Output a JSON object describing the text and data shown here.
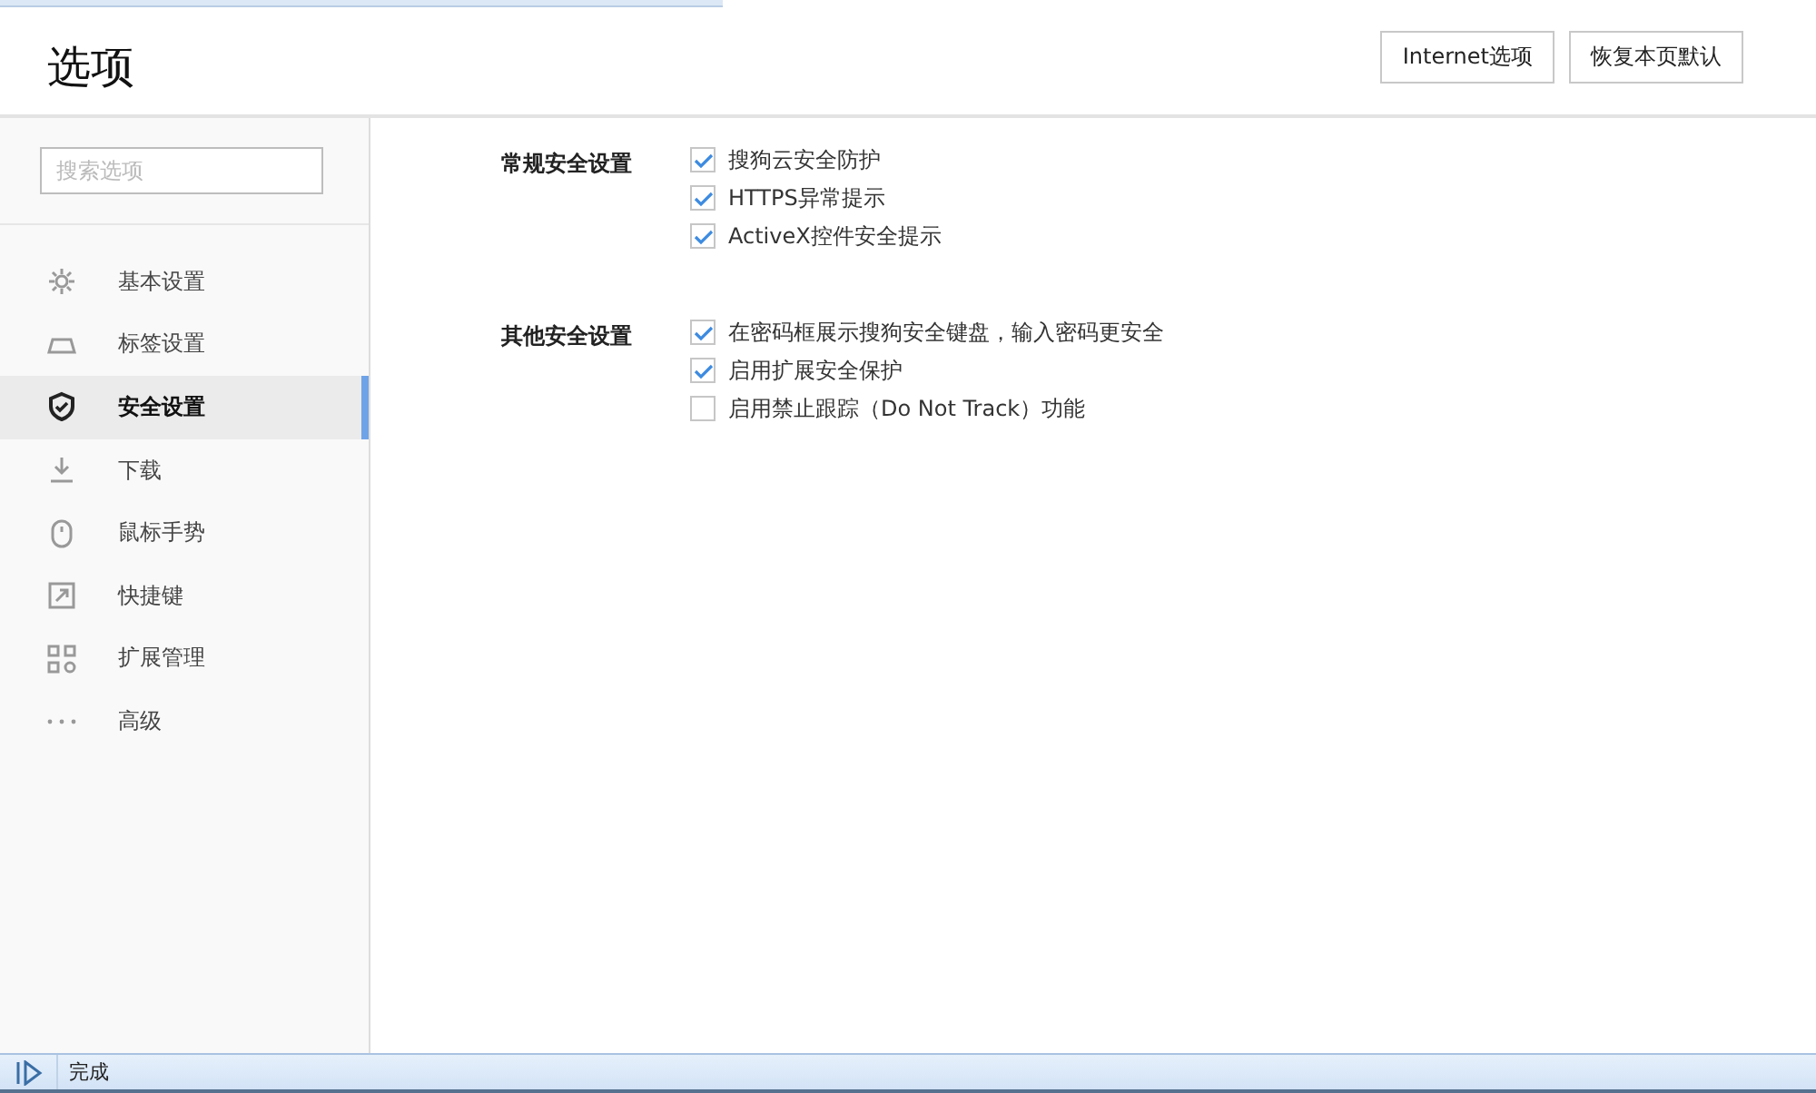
{
  "header": {
    "title": "选项",
    "buttons": [
      "Internet选项",
      "恢复本页默认"
    ]
  },
  "sidebar": {
    "search": {
      "placeholder": "搜索选项"
    },
    "items": [
      {
        "label": "基本设置",
        "selected": false
      },
      {
        "label": "标签设置",
        "selected": false
      },
      {
        "label": "安全设置",
        "selected": true
      },
      {
        "label": "下载",
        "selected": false
      },
      {
        "label": "鼠标手势",
        "selected": false
      },
      {
        "label": "快捷键",
        "selected": false
      },
      {
        "label": "扩展管理",
        "selected": false
      },
      {
        "label": "高级",
        "selected": false
      }
    ]
  },
  "sections": [
    {
      "title": "常规安全设置",
      "options": [
        {
          "label": "搜狗云安全防护",
          "checked": true
        },
        {
          "label": "HTTPS异常提示",
          "checked": true
        },
        {
          "label": "ActiveX控件安全提示",
          "checked": true
        }
      ]
    },
    {
      "title": "其他安全设置",
      "options": [
        {
          "label": "在密码框展示搜狗安全键盘，输入密码更安全",
          "checked": true
        },
        {
          "label": "启用扩展安全保护",
          "checked": true
        },
        {
          "label": "启用禁止跟踪（Do Not Track）功能",
          "checked": false
        }
      ]
    }
  ],
  "status_bar": {
    "text": "完成"
  }
}
